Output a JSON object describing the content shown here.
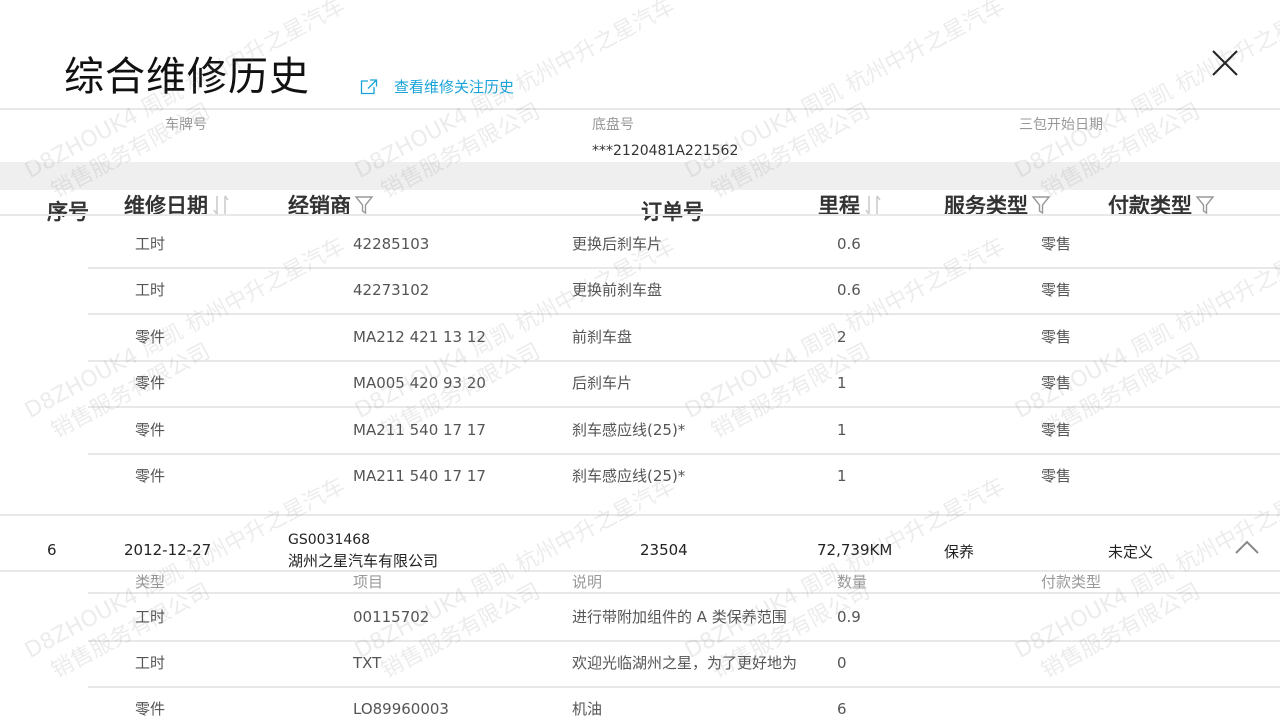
{
  "header": {
    "title": "综合维修历史",
    "history_link": "查看维修关注历史"
  },
  "vehicle_info": {
    "plate_label": "车牌号",
    "plate_value": "",
    "chassis_label": "底盘号",
    "chassis_value": "***2120481A221562",
    "warranty_label": "三包开始日期",
    "warranty_value": ""
  },
  "columns": {
    "index": "序号",
    "date": "维修日期",
    "dealer": "经销商",
    "order": "订单号",
    "mileage": "里程",
    "service_type": "服务类型",
    "payment_type": "付款类型"
  },
  "detail_rows_top": [
    {
      "type": "工时",
      "item": "42285103",
      "desc": "更换后刹车片",
      "qty": "0.6",
      "pay": "零售"
    },
    {
      "type": "工时",
      "item": "42273102",
      "desc": "更换前刹车盘",
      "qty": "0.6",
      "pay": "零售"
    },
    {
      "type": "零件",
      "item": "MA212 421 13 12",
      "desc": "前刹车盘",
      "qty": "2",
      "pay": "零售"
    },
    {
      "type": "零件",
      "item": "MA005 420 93 20",
      "desc": "后刹车片",
      "qty": "1",
      "pay": "零售"
    },
    {
      "type": "零件",
      "item": "MA211 540 17 17",
      "desc": "刹车感应线(25)*",
      "qty": "1",
      "pay": "零售"
    },
    {
      "type": "零件",
      "item": "MA211 540 17 17",
      "desc": "刹车感应线(25)*",
      "qty": "1",
      "pay": "零售"
    }
  ],
  "record": {
    "index": "6",
    "date": "2012-12-27",
    "dealer_code": "GS0031468",
    "dealer_name": "湖州之星汽车有限公司",
    "order": "23504",
    "mileage": "72,739KM",
    "service_type": "保养",
    "payment_type": "未定义"
  },
  "sub_columns": {
    "type": "类型",
    "item": "项目",
    "desc": "说明",
    "qty": "数量",
    "pay": "付款类型"
  },
  "detail_rows_bottom": [
    {
      "type": "工时",
      "item": "00115702",
      "desc": "进行带附加组件的 A 类保养范围",
      "qty": "0.9",
      "pay": ""
    },
    {
      "type": "工时",
      "item": "TXT",
      "desc": "欢迎光临湖州之星，为了更好地为",
      "qty": "0",
      "pay": ""
    },
    {
      "type": "零件",
      "item": "LO89960003",
      "desc": "机油",
      "qty": "6",
      "pay": ""
    }
  ],
  "watermark": {
    "line1": "D8ZHOUK4 周凯 杭州中升之星汽车",
    "line2": "销售服务有限公司"
  },
  "colors": {
    "accent": "#1aa3d9",
    "divider": "#e8e8e8",
    "band": "#efefef"
  }
}
